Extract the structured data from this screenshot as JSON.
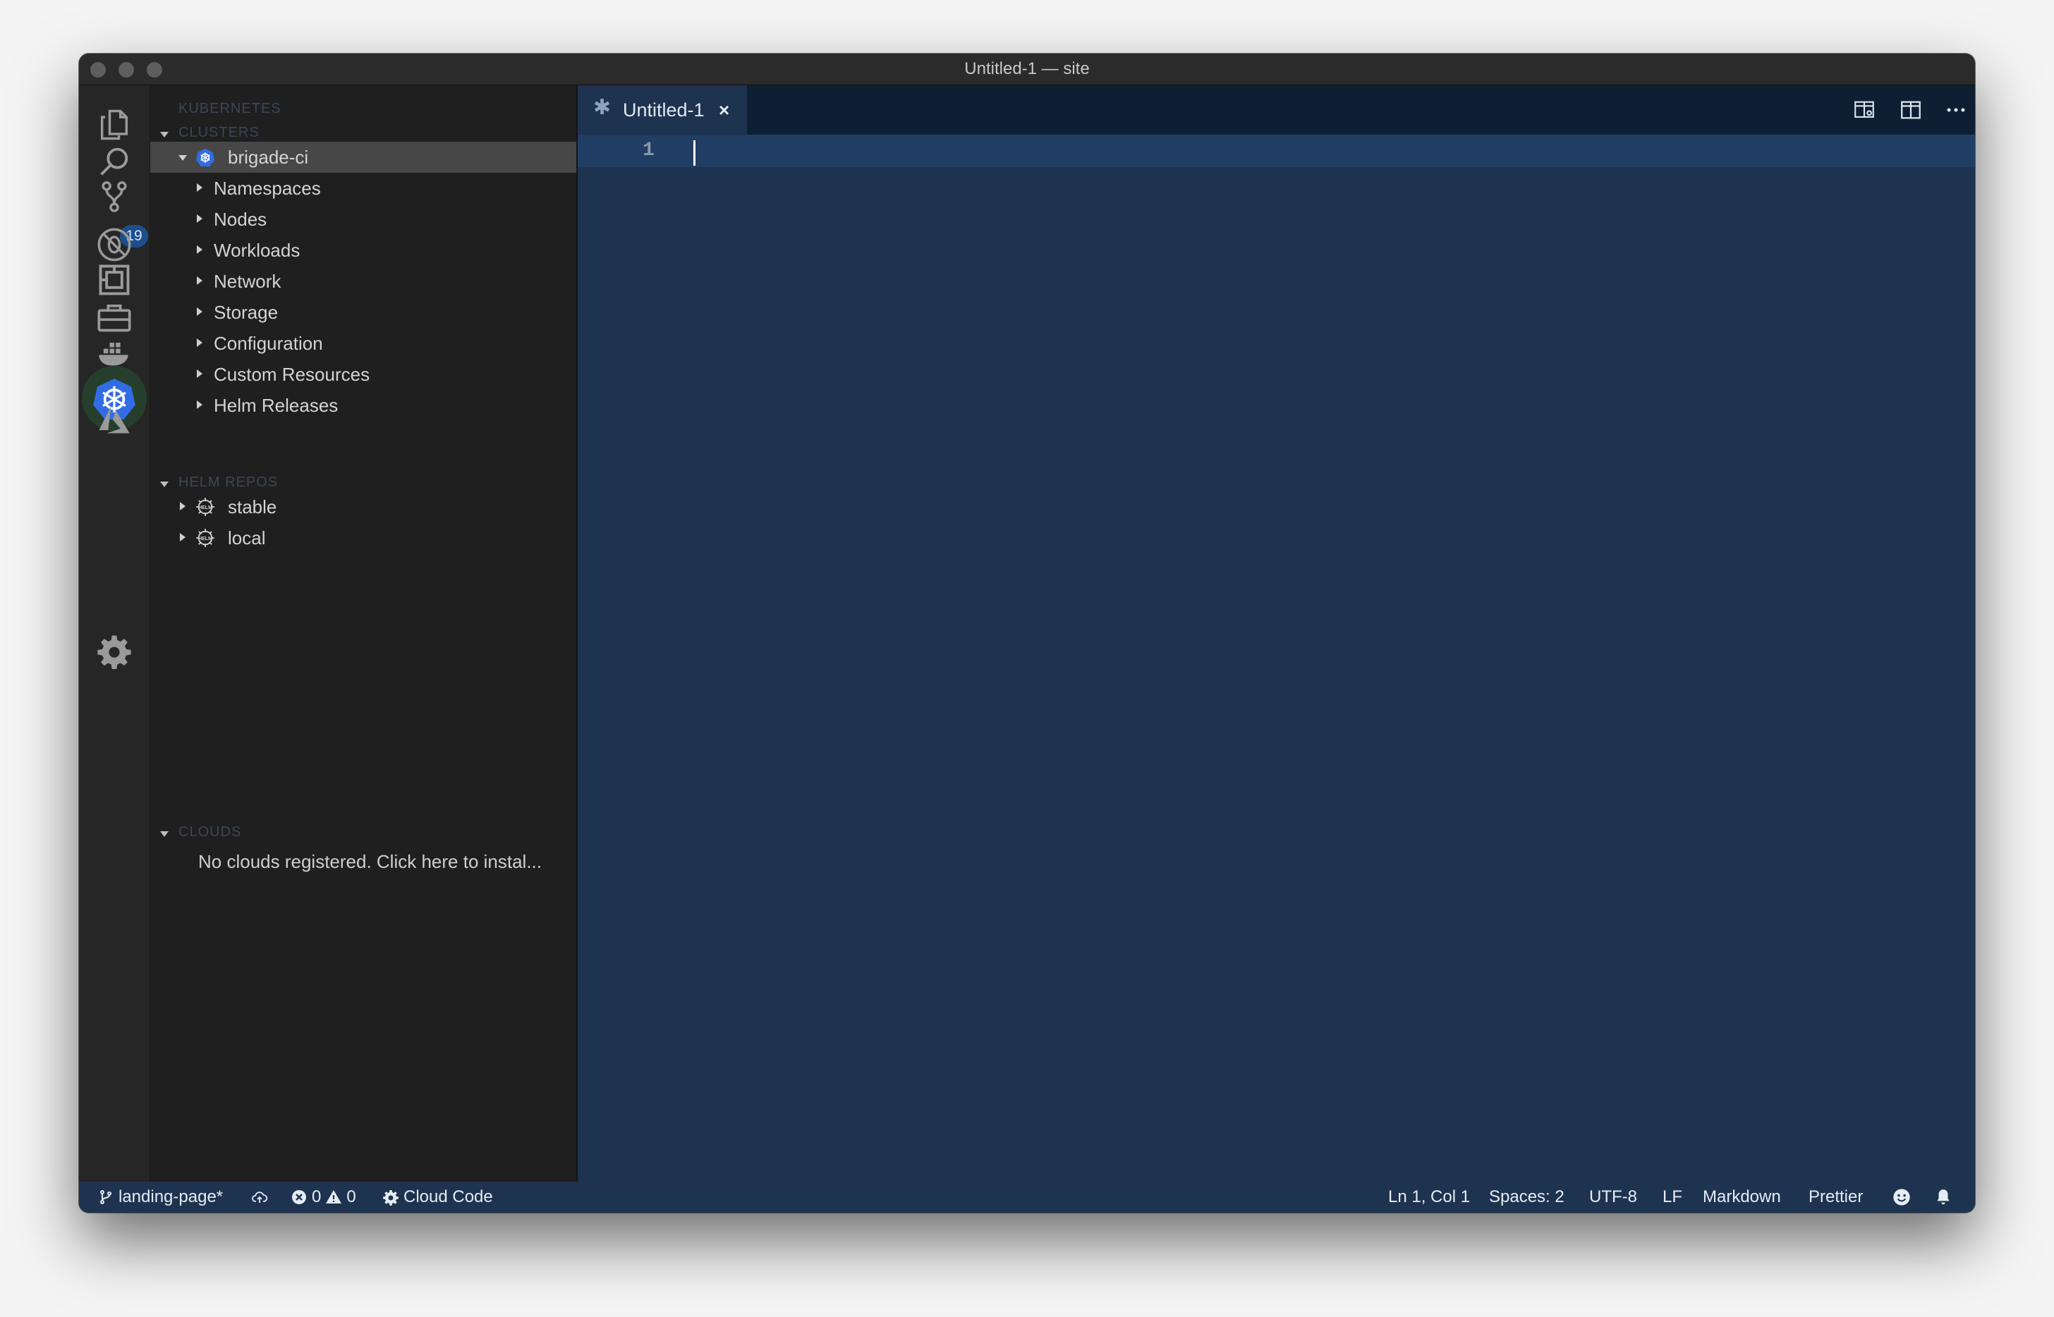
{
  "window": {
    "title": "Untitled-1 — site"
  },
  "activity_bar": {
    "source_control_badge": "19",
    "items": [
      "explorer-icon",
      "search-icon",
      "source-control-icon",
      "debug-icon",
      "extensions-icon",
      "remote-explorer-icon",
      "docker-icon",
      "kubernetes-icon",
      "azure-icon",
      "settings-gear-icon"
    ]
  },
  "sidebar": {
    "view_title": "KUBERNETES",
    "clusters": {
      "title": "CLUSTERS",
      "cluster": "brigade-ci",
      "children": [
        "Namespaces",
        "Nodes",
        "Workloads",
        "Network",
        "Storage",
        "Configuration",
        "Custom Resources",
        "Helm Releases"
      ]
    },
    "helm_repos": {
      "title": "HELM REPOS",
      "items": [
        "stable",
        "local"
      ]
    },
    "clouds": {
      "title": "CLOUDS",
      "message": "No clouds registered. Click here to instal..."
    }
  },
  "editor": {
    "tab": {
      "dirty_marker": "✱",
      "label": "Untitled-1",
      "close": "×"
    },
    "line_number": "1"
  },
  "status_bar": {
    "branch": "landing-page*",
    "errors": "0",
    "warnings": "0",
    "cloud_code": "Cloud Code",
    "position": "Ln 1, Col 1",
    "spaces": "Spaces: 2",
    "encoding": "UTF-8",
    "eol": "LF",
    "language": "Markdown",
    "formatter": "Prettier"
  },
  "colors": {
    "editor_bg": "#1d3350",
    "tabbar_bg": "#0e1f33",
    "sidebar_bg": "#1f1f1f",
    "accent_k8s": "#326ce5"
  }
}
